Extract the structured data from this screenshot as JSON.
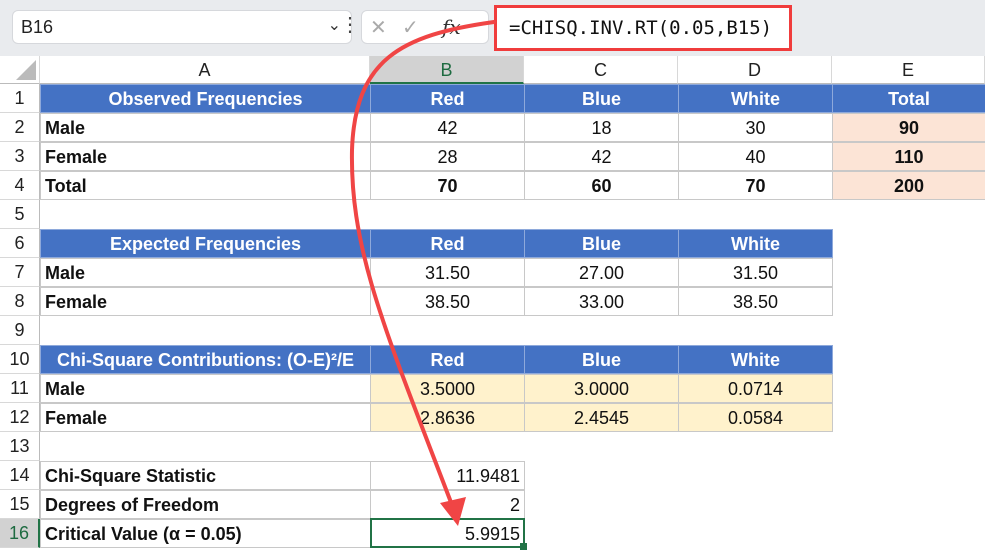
{
  "name_box": "B16",
  "formula": "=CHISQ.INV.RT(0.05,B15)",
  "fx_label": "fx",
  "columns": [
    "A",
    "B",
    "C",
    "D",
    "E"
  ],
  "selected_column": "B",
  "selected_row": "16",
  "rows": [
    {
      "n": "1",
      "type": "hdr",
      "cells": [
        "Observed Frequencies",
        "Red",
        "Blue",
        "White",
        "Total"
      ]
    },
    {
      "n": "2",
      "type": "data",
      "cells": [
        "Male",
        "42",
        "18",
        "30",
        "90"
      ]
    },
    {
      "n": "3",
      "type": "data",
      "cells": [
        "Female",
        "28",
        "42",
        "40",
        "110"
      ]
    },
    {
      "n": "4",
      "type": "total",
      "cells": [
        "Total",
        "70",
        "60",
        "70",
        "200"
      ]
    },
    {
      "n": "5",
      "type": "blank",
      "cells": []
    },
    {
      "n": "6",
      "type": "hdr",
      "cells": [
        "Expected Frequencies",
        "Red",
        "Blue",
        "White"
      ]
    },
    {
      "n": "7",
      "type": "data",
      "cells": [
        "Male",
        "31.50",
        "27.00",
        "31.50"
      ]
    },
    {
      "n": "8",
      "type": "data",
      "cells": [
        "Female",
        "38.50",
        "33.00",
        "38.50"
      ]
    },
    {
      "n": "9",
      "type": "blank",
      "cells": []
    },
    {
      "n": "10",
      "type": "hdr",
      "cells": [
        "Chi-Square Contributions: (O-E)²/E",
        "Red",
        "Blue",
        "White"
      ]
    },
    {
      "n": "11",
      "type": "contrib",
      "cells": [
        "Male",
        "3.5000",
        "3.0000",
        "0.0714"
      ]
    },
    {
      "n": "12",
      "type": "contrib",
      "cells": [
        "Female",
        "2.8636",
        "2.4545",
        "0.0584"
      ]
    },
    {
      "n": "13",
      "type": "blank",
      "cells": []
    },
    {
      "n": "14",
      "type": "stat",
      "cells": [
        "Chi-Square Statistic",
        "11.9481"
      ]
    },
    {
      "n": "15",
      "type": "stat",
      "cells": [
        "Degrees of Freedom",
        "2"
      ]
    },
    {
      "n": "16",
      "type": "stat",
      "cells": [
        "Critical Value (α = 0.05)",
        "5.9915"
      ]
    }
  ],
  "colors": {
    "header": "#4472c4",
    "total": "#fce4d6",
    "contrib": "#fff2cc",
    "arrow": "#f04040",
    "selection": "#217346"
  }
}
